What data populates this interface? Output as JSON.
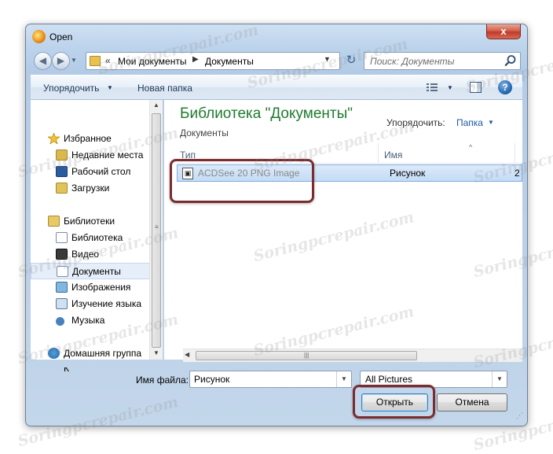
{
  "window": {
    "title": "Open",
    "close_glyph": "x"
  },
  "nav": {
    "back": "◀",
    "forward": "▶",
    "history": "▼"
  },
  "address": {
    "chevron": "«",
    "crumbs": [
      "Мои документы",
      "Документы"
    ],
    "separator": "▶",
    "dropdown": "▼",
    "refresh": "↻"
  },
  "search": {
    "placeholder": "Поиск: Документы"
  },
  "toolbar": {
    "organize_label": "Упорядочить",
    "new_folder_label": "Новая папка",
    "caret": "▼",
    "help_glyph": "?"
  },
  "sidebar": {
    "favorites": "Избранное",
    "favorites_items": [
      "Недавние места",
      "Рабочий стол",
      "Загрузки"
    ],
    "libraries": "Библиотеки",
    "libraries_items": [
      "Библиотека",
      "Видео",
      "Документы",
      "Изображения",
      "Изучение языка",
      "Музыка"
    ],
    "homegroup": "Домашняя группа",
    "computer_partial": "К"
  },
  "content": {
    "library_title": "Библиотека \"Документы\"",
    "library_subtitle": "Документы",
    "arrange_label": "Упорядочить:",
    "arrange_value": "Папка",
    "columns": {
      "type": "Тип",
      "name": "Имя"
    },
    "sort_glyph": "^",
    "file": {
      "type": "ACDSee 20 PNG Image",
      "name": "Рисунок",
      "extra": "2"
    }
  },
  "bottom": {
    "filename_label": "Имя файла:",
    "filename_value": "Рисунок",
    "filter_value": "All Pictures",
    "open_label": "Открыть",
    "cancel_label": "Отмена"
  },
  "watermark": {
    "text": "Soringpcrepair.com"
  },
  "colors": {
    "accent_title": "#1e7b2f",
    "link": "#1e5aa8",
    "highlight_box": "#7b2c2f",
    "selection": "#c3dcf6"
  }
}
